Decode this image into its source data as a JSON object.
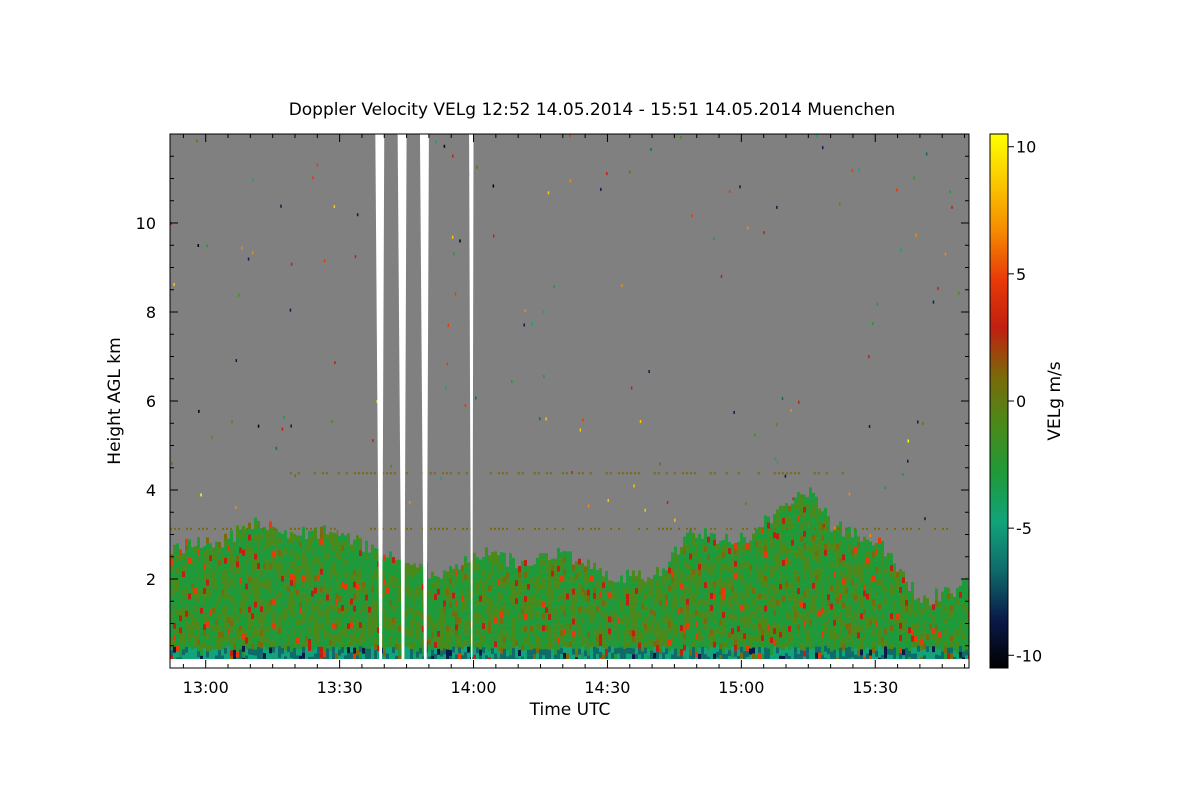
{
  "chart_data": {
    "type": "heatmap",
    "title": "Doppler Velocity VELg   12:52 14.05.2014 - 15:51 14.05.2014 Muenchen",
    "xlabel": "Time UTC",
    "ylabel": "Height AGL km",
    "xlim": [
      "12:52",
      "15:51"
    ],
    "ylim": [
      0,
      12
    ],
    "x_ticks": [
      {
        "time": "13:00",
        "label": "13:00"
      },
      {
        "time": "13:30",
        "label": "13:30"
      },
      {
        "time": "14:00",
        "label": "14:00"
      },
      {
        "time": "14:30",
        "label": "14:30"
      },
      {
        "time": "15:00",
        "label": "15:00"
      },
      {
        "time": "15:30",
        "label": "15:30"
      }
    ],
    "y_ticks": [
      {
        "value": 2,
        "label": "2"
      },
      {
        "value": 4,
        "label": "4"
      },
      {
        "value": 6,
        "label": "6"
      },
      {
        "value": 8,
        "label": "8"
      },
      {
        "value": 10,
        "label": "10"
      }
    ],
    "colorbar": {
      "label": "VELg m/s",
      "range": [
        -10.5,
        10.5
      ],
      "ticks": [
        {
          "value": 10,
          "label": "10"
        },
        {
          "value": 5,
          "label": "5"
        },
        {
          "value": 0,
          "label": "0"
        },
        {
          "value": -5,
          "label": "-5"
        },
        {
          "value": -10,
          "label": "-10"
        }
      ],
      "colors": [
        "#000000",
        "#0a1a4a",
        "#0f6a6a",
        "#11a37a",
        "#1f9a3a",
        "#4a8a1a",
        "#7a6a0a",
        "#c02010",
        "#e83a08",
        "#f58a00",
        "#fac800",
        "#ffff00"
      ]
    },
    "background_color": "#808080",
    "gaps_utc": [
      [
        "13:38",
        "13:40"
      ],
      [
        "13:43",
        "13:45"
      ],
      [
        "13:48",
        "13:50"
      ],
      [
        "13:59",
        "14:00"
      ]
    ],
    "echo_top_profile_km": [
      {
        "time": "12:52",
        "top": 2.7
      },
      {
        "time": "13:05",
        "top": 2.9
      },
      {
        "time": "13:10",
        "top": 3.3
      },
      {
        "time": "13:20",
        "top": 3.0
      },
      {
        "time": "13:30",
        "top": 3.1
      },
      {
        "time": "13:37",
        "top": 2.6
      },
      {
        "time": "13:52",
        "top": 2.1
      },
      {
        "time": "14:00",
        "top": 2.6
      },
      {
        "time": "14:10",
        "top": 2.4
      },
      {
        "time": "14:20",
        "top": 2.6
      },
      {
        "time": "14:30",
        "top": 2.1
      },
      {
        "time": "14:40",
        "top": 2.0
      },
      {
        "time": "14:48",
        "top": 3.0
      },
      {
        "time": "15:00",
        "top": 2.9
      },
      {
        "time": "15:10",
        "top": 3.6
      },
      {
        "time": "15:15",
        "top": 4.0
      },
      {
        "time": "15:20",
        "top": 3.2
      },
      {
        "time": "15:30",
        "top": 2.9
      },
      {
        "time": "15:40",
        "top": 1.5
      },
      {
        "time": "15:51",
        "top": 1.9
      }
    ]
  }
}
